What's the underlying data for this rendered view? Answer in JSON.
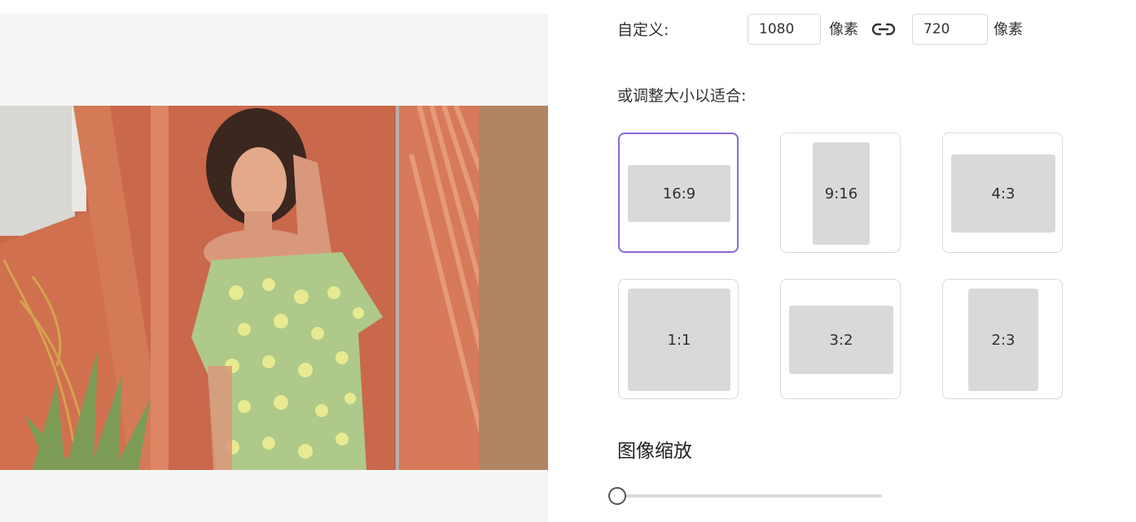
{
  "resize": {
    "custom_label": "自定义:",
    "width_value": "1080",
    "height_value": "720",
    "unit": "像素",
    "link_icon": "link-icon",
    "fit_label": "或调整大小以适合:"
  },
  "ratios": [
    {
      "label": "16:9",
      "selected": true
    },
    {
      "label": "9:16",
      "selected": false
    },
    {
      "label": "4:3",
      "selected": false
    },
    {
      "label": "1:1",
      "selected": false
    },
    {
      "label": "3:2",
      "selected": false
    },
    {
      "label": "2:3",
      "selected": false
    }
  ],
  "zoom": {
    "title": "图像缩放",
    "value": 0
  },
  "colors": {
    "selected_border": "#8d66d8",
    "shape_fill": "#d9d9d9"
  }
}
